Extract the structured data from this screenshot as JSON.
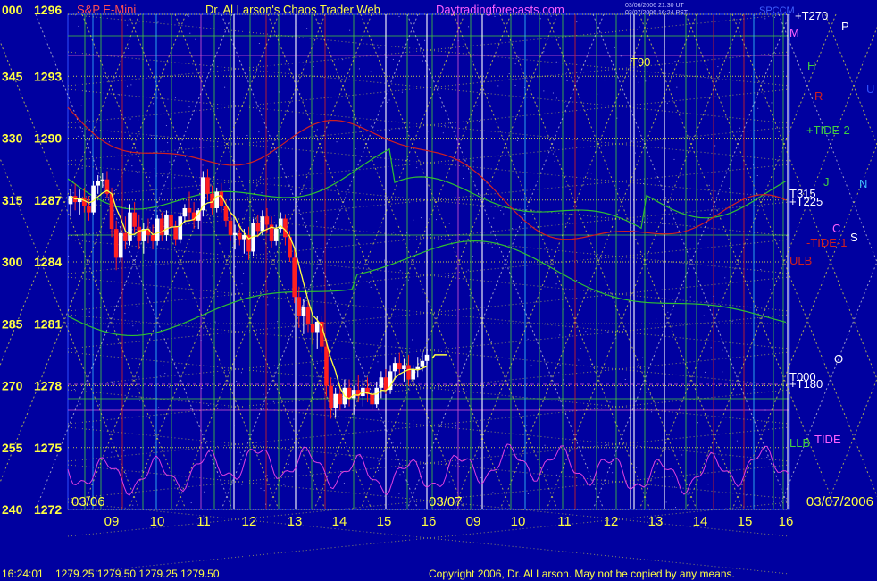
{
  "header": {
    "left_label": "000",
    "price_label": "1296",
    "symbol": "S&P E-Mini",
    "title": "Dr. Al Larson's Chaos Trader Web",
    "site": "Daytradingforecasts.com",
    "stamp_line1": "03/06/2006 21:30 UT",
    "stamp_line2": "03/07/2006 16:24 PST",
    "spccm": "SPCCM"
  },
  "footer": {
    "time": "16:24:01",
    "ohlc": "1279.25  1279.50  1279.25  1279.50",
    "copyright": "Copyright 2006, Dr. Al Larson. May not be copied by any means."
  },
  "colors": {
    "background": "#0000a0",
    "price_up": "#ffffff",
    "price_down": "#ff2020",
    "grid_yellow": "#e0e040",
    "moving_avg": "#ffff40",
    "tide_green": "#30c030",
    "tide_red": "#d02020",
    "oscillator": "#e040e0"
  },
  "chart_data": {
    "type": "candlestick",
    "ylim": [
      1272,
      1296
    ],
    "y_ticks": [
      {
        "angle": "000",
        "price": "1296"
      },
      {
        "angle": "345",
        "price": "1293"
      },
      {
        "angle": "330",
        "price": "1290"
      },
      {
        "angle": "315",
        "price": "1287"
      },
      {
        "angle": "300",
        "price": "1284"
      },
      {
        "angle": "285",
        "price": "1281"
      },
      {
        "angle": "270",
        "price": "1278"
      },
      {
        "angle": "255",
        "price": "1275"
      },
      {
        "angle": "240",
        "price": "1272"
      }
    ],
    "x_ticks": [
      "09",
      "10",
      "11",
      "12",
      "13",
      "14",
      "15",
      "16",
      "09",
      "10",
      "11",
      "12",
      "13",
      "14",
      "15",
      "16"
    ],
    "date_labels": [
      "03/06",
      "03/07",
      "03/07/2006"
    ],
    "candles": [
      [
        1286.8,
        1287.5,
        1286.2,
        1287.2
      ],
      [
        1287.2,
        1287.8,
        1286.5,
        1286.9
      ],
      [
        1286.9,
        1287.5,
        1286.3,
        1287.1
      ],
      [
        1287.1,
        1287.6,
        1286.4,
        1286.7
      ],
      [
        1286.7,
        1287.2,
        1286.0,
        1286.4
      ],
      [
        1286.4,
        1287.9,
        1286.3,
        1287.7
      ],
      [
        1287.7,
        1288.2,
        1287.3,
        1287.9
      ],
      [
        1287.9,
        1288.3,
        1287.6,
        1288.0
      ],
      [
        1288.0,
        1288.4,
        1287.1,
        1287.3
      ],
      [
        1287.3,
        1287.6,
        1285.2,
        1285.6
      ],
      [
        1285.6,
        1286.0,
        1283.6,
        1284.2
      ],
      [
        1284.2,
        1285.7,
        1284.0,
        1285.4
      ],
      [
        1285.4,
        1286.2,
        1284.6,
        1285.0
      ],
      [
        1285.0,
        1286.8,
        1284.8,
        1286.4
      ],
      [
        1286.4,
        1286.9,
        1285.4,
        1285.7
      ],
      [
        1285.7,
        1286.3,
        1284.6,
        1285.0
      ],
      [
        1285.0,
        1285.9,
        1284.4,
        1285.6
      ],
      [
        1285.6,
        1286.1,
        1284.9,
        1285.3
      ],
      [
        1285.3,
        1285.8,
        1284.6,
        1285.0
      ],
      [
        1285.0,
        1286.3,
        1284.8,
        1286.1
      ],
      [
        1286.1,
        1286.4,
        1285.0,
        1285.3
      ],
      [
        1285.3,
        1286.5,
        1285.0,
        1286.3
      ],
      [
        1286.3,
        1286.6,
        1285.5,
        1285.7
      ],
      [
        1285.7,
        1286.0,
        1284.8,
        1285.1
      ],
      [
        1285.1,
        1286.4,
        1284.9,
        1286.2
      ],
      [
        1286.2,
        1286.8,
        1285.9,
        1286.6
      ],
      [
        1286.6,
        1287.4,
        1286.0,
        1286.4
      ],
      [
        1286.4,
        1286.9,
        1285.6,
        1286.0
      ],
      [
        1286.0,
        1286.6,
        1285.6,
        1286.5
      ],
      [
        1286.5,
        1288.4,
        1286.2,
        1288.1
      ],
      [
        1288.1,
        1288.5,
        1287.0,
        1287.3
      ],
      [
        1287.3,
        1287.7,
        1286.3,
        1286.6
      ],
      [
        1286.6,
        1287.6,
        1286.4,
        1287.4
      ],
      [
        1287.4,
        1287.8,
        1286.4,
        1286.7
      ],
      [
        1286.7,
        1287.0,
        1285.7,
        1286.0
      ],
      [
        1286.0,
        1286.4,
        1285.0,
        1285.3
      ],
      [
        1285.3,
        1285.8,
        1284.6,
        1285.4
      ],
      [
        1285.4,
        1285.9,
        1284.8,
        1285.1
      ],
      [
        1285.1,
        1285.6,
        1284.4,
        1285.3
      ],
      [
        1285.3,
        1285.7,
        1284.1,
        1284.5
      ],
      [
        1284.5,
        1286.1,
        1284.3,
        1285.9
      ],
      [
        1285.9,
        1286.3,
        1285.2,
        1285.5
      ],
      [
        1285.5,
        1286.5,
        1285.3,
        1286.2
      ],
      [
        1286.2,
        1286.6,
        1285.4,
        1285.8
      ],
      [
        1285.8,
        1286.2,
        1284.7,
        1285.0
      ],
      [
        1285.0,
        1285.8,
        1284.8,
        1285.6
      ],
      [
        1285.6,
        1286.4,
        1285.4,
        1286.1
      ],
      [
        1286.1,
        1286.3,
        1284.8,
        1285.2
      ],
      [
        1285.2,
        1285.5,
        1284.0,
        1284.2
      ],
      [
        1284.2,
        1284.6,
        1282.0,
        1282.3
      ],
      [
        1282.3,
        1282.8,
        1280.8,
        1281.4
      ],
      [
        1281.4,
        1282.2,
        1280.5,
        1281.8
      ],
      [
        1281.8,
        1282.1,
        1280.6,
        1281.0
      ],
      [
        1281.0,
        1281.5,
        1280.0,
        1280.6
      ],
      [
        1280.6,
        1281.4,
        1279.8,
        1281.1
      ],
      [
        1281.1,
        1281.4,
        1279.6,
        1279.9
      ],
      [
        1279.9,
        1280.3,
        1277.5,
        1278.0
      ],
      [
        1278.0,
        1278.4,
        1276.4,
        1276.9
      ],
      [
        1276.9,
        1277.9,
        1276.5,
        1277.6
      ],
      [
        1277.6,
        1278.0,
        1276.8,
        1277.1
      ],
      [
        1277.1,
        1278.3,
        1276.9,
        1277.9
      ],
      [
        1277.9,
        1278.3,
        1277.0,
        1277.4
      ],
      [
        1277.4,
        1278.0,
        1276.6,
        1277.8
      ],
      [
        1277.8,
        1278.5,
        1277.2,
        1277.5
      ],
      [
        1277.5,
        1278.3,
        1277.0,
        1277.9
      ],
      [
        1277.9,
        1278.4,
        1277.2,
        1277.6
      ],
      [
        1277.6,
        1278.0,
        1276.8,
        1277.1
      ],
      [
        1277.1,
        1278.2,
        1276.9,
        1277.9
      ],
      [
        1277.9,
        1278.7,
        1277.4,
        1278.4
      ],
      [
        1278.4,
        1278.8,
        1277.6,
        1277.8
      ],
      [
        1277.8,
        1279.0,
        1277.6,
        1278.7
      ],
      [
        1278.7,
        1279.4,
        1278.3,
        1279.1
      ],
      [
        1279.1,
        1279.6,
        1278.5,
        1278.8
      ],
      [
        1278.8,
        1279.3,
        1278.2,
        1279.0
      ],
      [
        1279.0,
        1279.5,
        1278.0,
        1278.3
      ],
      [
        1278.3,
        1279.0,
        1278.0,
        1278.8
      ],
      [
        1278.8,
        1279.4,
        1278.4,
        1278.9
      ],
      [
        1278.9,
        1279.6,
        1278.7,
        1279.2
      ],
      [
        1279.2,
        1279.8,
        1279.0,
        1279.5
      ]
    ],
    "forecast_labels": [
      "+T270",
      "M",
      "P",
      "T90",
      "H",
      "R",
      "U",
      "+TIDE-2",
      "J",
      "N",
      "T315",
      "+T225",
      "C",
      "-TIDE-1",
      "S",
      "ULB",
      "O",
      "T000",
      "+T180",
      "LLB",
      "TIDE"
    ]
  }
}
